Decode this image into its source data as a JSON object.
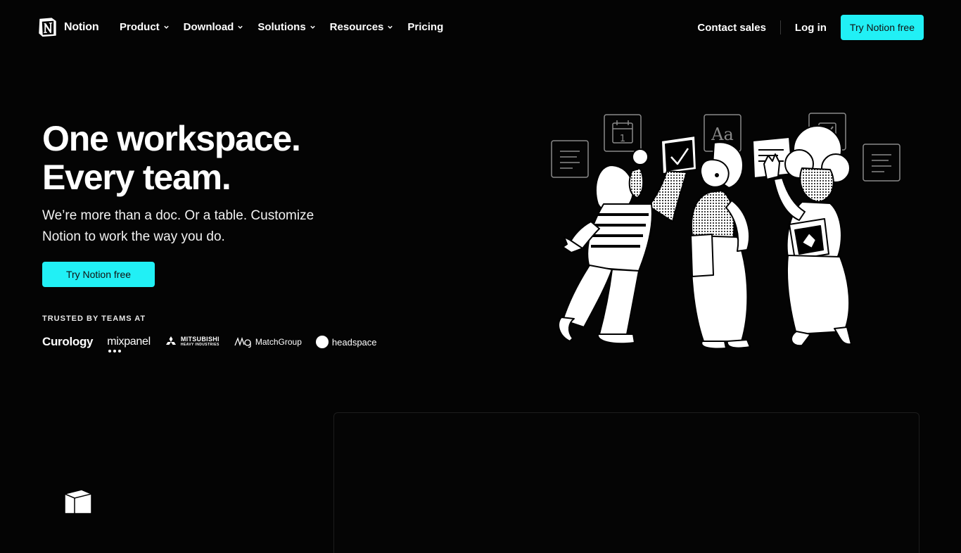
{
  "nav": {
    "brand": "Notion",
    "menu": [
      {
        "label": "Product",
        "dropdown": true
      },
      {
        "label": "Download",
        "dropdown": true
      },
      {
        "label": "Solutions",
        "dropdown": true
      },
      {
        "label": "Resources",
        "dropdown": true
      },
      {
        "label": "Pricing",
        "dropdown": false
      }
    ],
    "contact_sales": "Contact sales",
    "login": "Log in",
    "cta": "Try Notion free"
  },
  "hero": {
    "title_line1": "One workspace.",
    "title_line2": "Every team.",
    "subtitle": "We’re more than a doc. Or a table. Customize Notion to work the way you do.",
    "cta": "Try Notion free",
    "trusted_label": "TRUSTED BY TEAMS AT",
    "logos": {
      "curology": "Curology",
      "mixpanel": "mixpanel",
      "mitsubishi": "MITSUBISHI",
      "mitsubishi_sub": "HEAVY INDUSTRIES",
      "matchgroup": "MatchGroup",
      "headspace": "headspace"
    }
  },
  "illustration": {
    "calendar_day": "1",
    "font_tile": "Aa"
  },
  "colors": {
    "background": "#040404",
    "accent": "#21f0f5",
    "text": "#ffffff"
  },
  "icons": [
    "notion-logo-icon",
    "chevron-down-icon",
    "calendar-icon",
    "checkbox-icon",
    "document-icon",
    "font-icon"
  ]
}
